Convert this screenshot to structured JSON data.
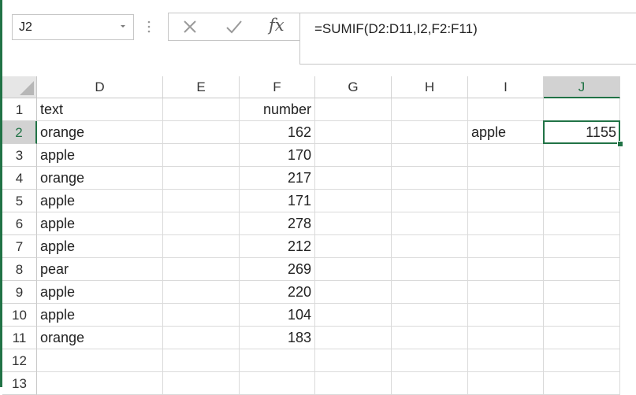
{
  "name_box": {
    "value": "J2"
  },
  "formula_bar": {
    "formula": "=SUMIF(D2:D11,I2,F2:F11)",
    "fx_label": "fx"
  },
  "columns": [
    "D",
    "E",
    "F",
    "G",
    "H",
    "I",
    "J"
  ],
  "rows": [
    "1",
    "2",
    "3",
    "4",
    "5",
    "6",
    "7",
    "8",
    "9",
    "10",
    "11",
    "12",
    "13"
  ],
  "selected": {
    "column": "J",
    "row": "2"
  },
  "cells": {
    "D1": "text",
    "F1": "number",
    "D2": "orange",
    "F2": "162",
    "I2": "apple",
    "J2": "1155",
    "D3": "apple",
    "F3": "170",
    "D4": "orange",
    "F4": "217",
    "D5": "apple",
    "F5": "171",
    "D6": "apple",
    "F6": "278",
    "D7": "apple",
    "F7": "212",
    "D8": "pear",
    "F8": "269",
    "D9": "apple",
    "F9": "220",
    "D10": "apple",
    "F10": "104",
    "D11": "orange",
    "F11": "183"
  },
  "colors": {
    "accent": "#217346",
    "header_selected": "#d2d2d2"
  }
}
